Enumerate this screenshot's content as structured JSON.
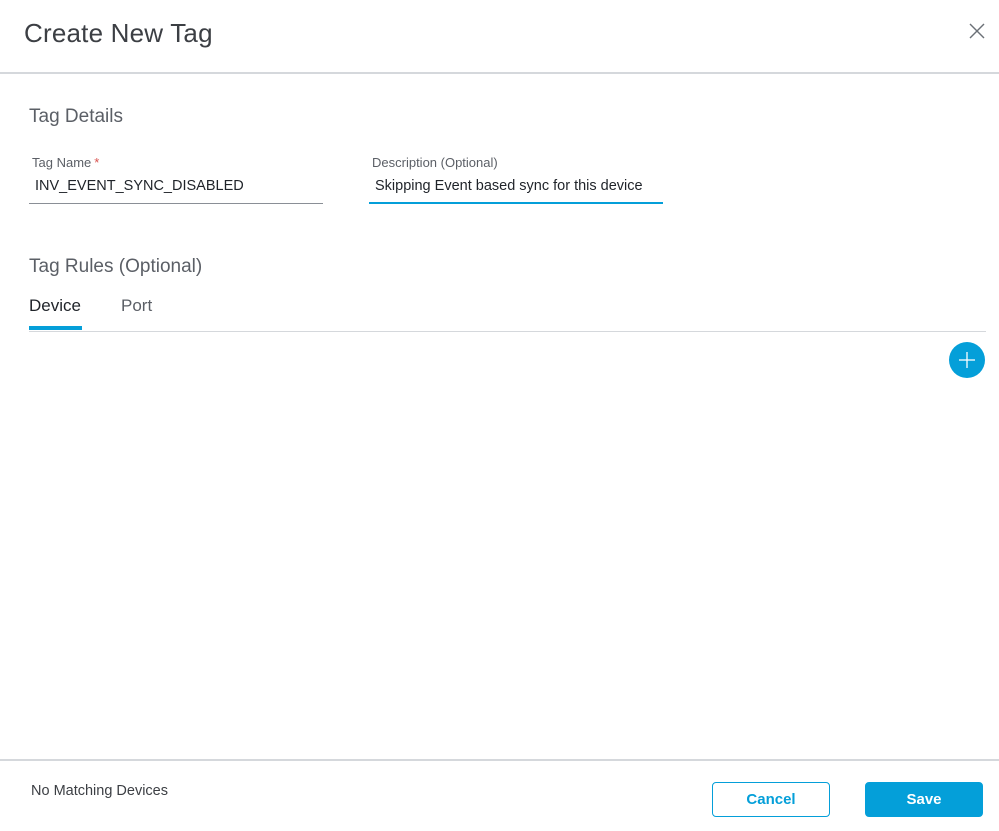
{
  "dialog": {
    "title": "Create New Tag"
  },
  "details": {
    "section_title": "Tag Details",
    "tag_name": {
      "label": "Tag Name",
      "required_marker": "*",
      "value": "INV_EVENT_SYNC_DISABLED"
    },
    "description": {
      "label": "Description (Optional)",
      "value": "Skipping Event based sync for this device"
    }
  },
  "rules": {
    "section_title": "Tag Rules (Optional)",
    "tabs": [
      {
        "label": "Device",
        "active": true
      },
      {
        "label": "Port",
        "active": false
      }
    ]
  },
  "footer": {
    "status": "No Matching Devices",
    "cancel_label": "Cancel",
    "save_label": "Save"
  },
  "icons": {
    "close": "close-icon",
    "add": "plus-icon"
  },
  "colors": {
    "accent": "#049fd9",
    "required": "#d9534f"
  }
}
